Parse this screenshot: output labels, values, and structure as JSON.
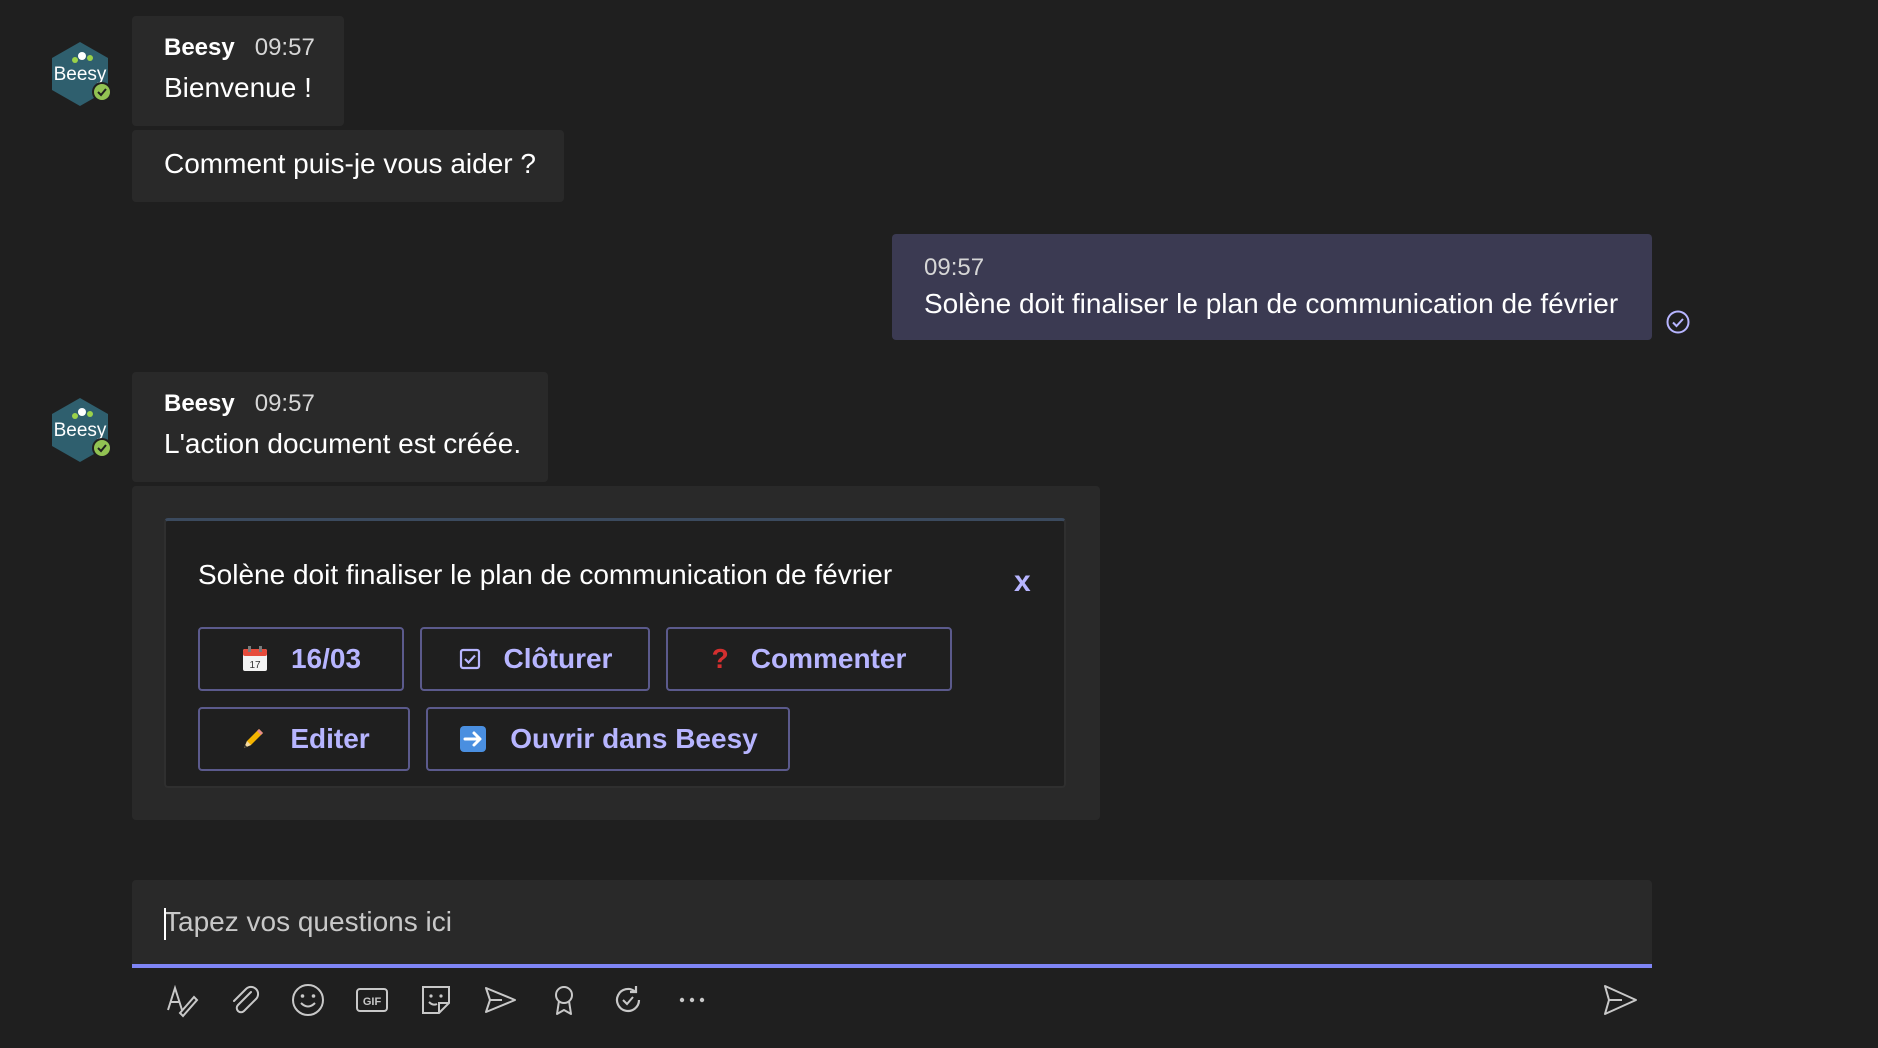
{
  "messages": [
    {
      "sender": "Beesy",
      "time": "09:57",
      "lines": [
        "Bienvenue !",
        "Comment puis-je vous aider ?"
      ]
    },
    {
      "time": "09:57",
      "text": "Solène doit finaliser le plan de communication de février"
    },
    {
      "sender": "Beesy",
      "time": "09:57",
      "text": "L'action document est créée."
    }
  ],
  "avatar_label": "Beesy",
  "card": {
    "title": "Solène doit finaliser le plan de communication de février",
    "close_label": "x",
    "buttons": [
      {
        "label": "16/03",
        "icon": "calendar-icon"
      },
      {
        "label": "Clôturer",
        "icon": "checkbox-icon"
      },
      {
        "label": "Commenter",
        "icon": "question-mark-icon"
      },
      {
        "label": "Editer",
        "icon": "pencil-icon"
      },
      {
        "label": "Ouvrir dans Beesy",
        "icon": "arrow-right-icon"
      }
    ]
  },
  "composer": {
    "placeholder": "Tapez vos questions ici"
  },
  "toolbar": [
    "format-icon",
    "attach-icon",
    "emoji-icon",
    "gif-icon",
    "sticker-icon",
    "meet-icon",
    "praise-icon",
    "loop-icon",
    "more-icon"
  ],
  "colors": {
    "background": "#1f1f1f",
    "bubble": "#292929",
    "my_bubble": "#3b3a52",
    "accent": "#b7b5ff",
    "underline": "#7f85f5"
  }
}
